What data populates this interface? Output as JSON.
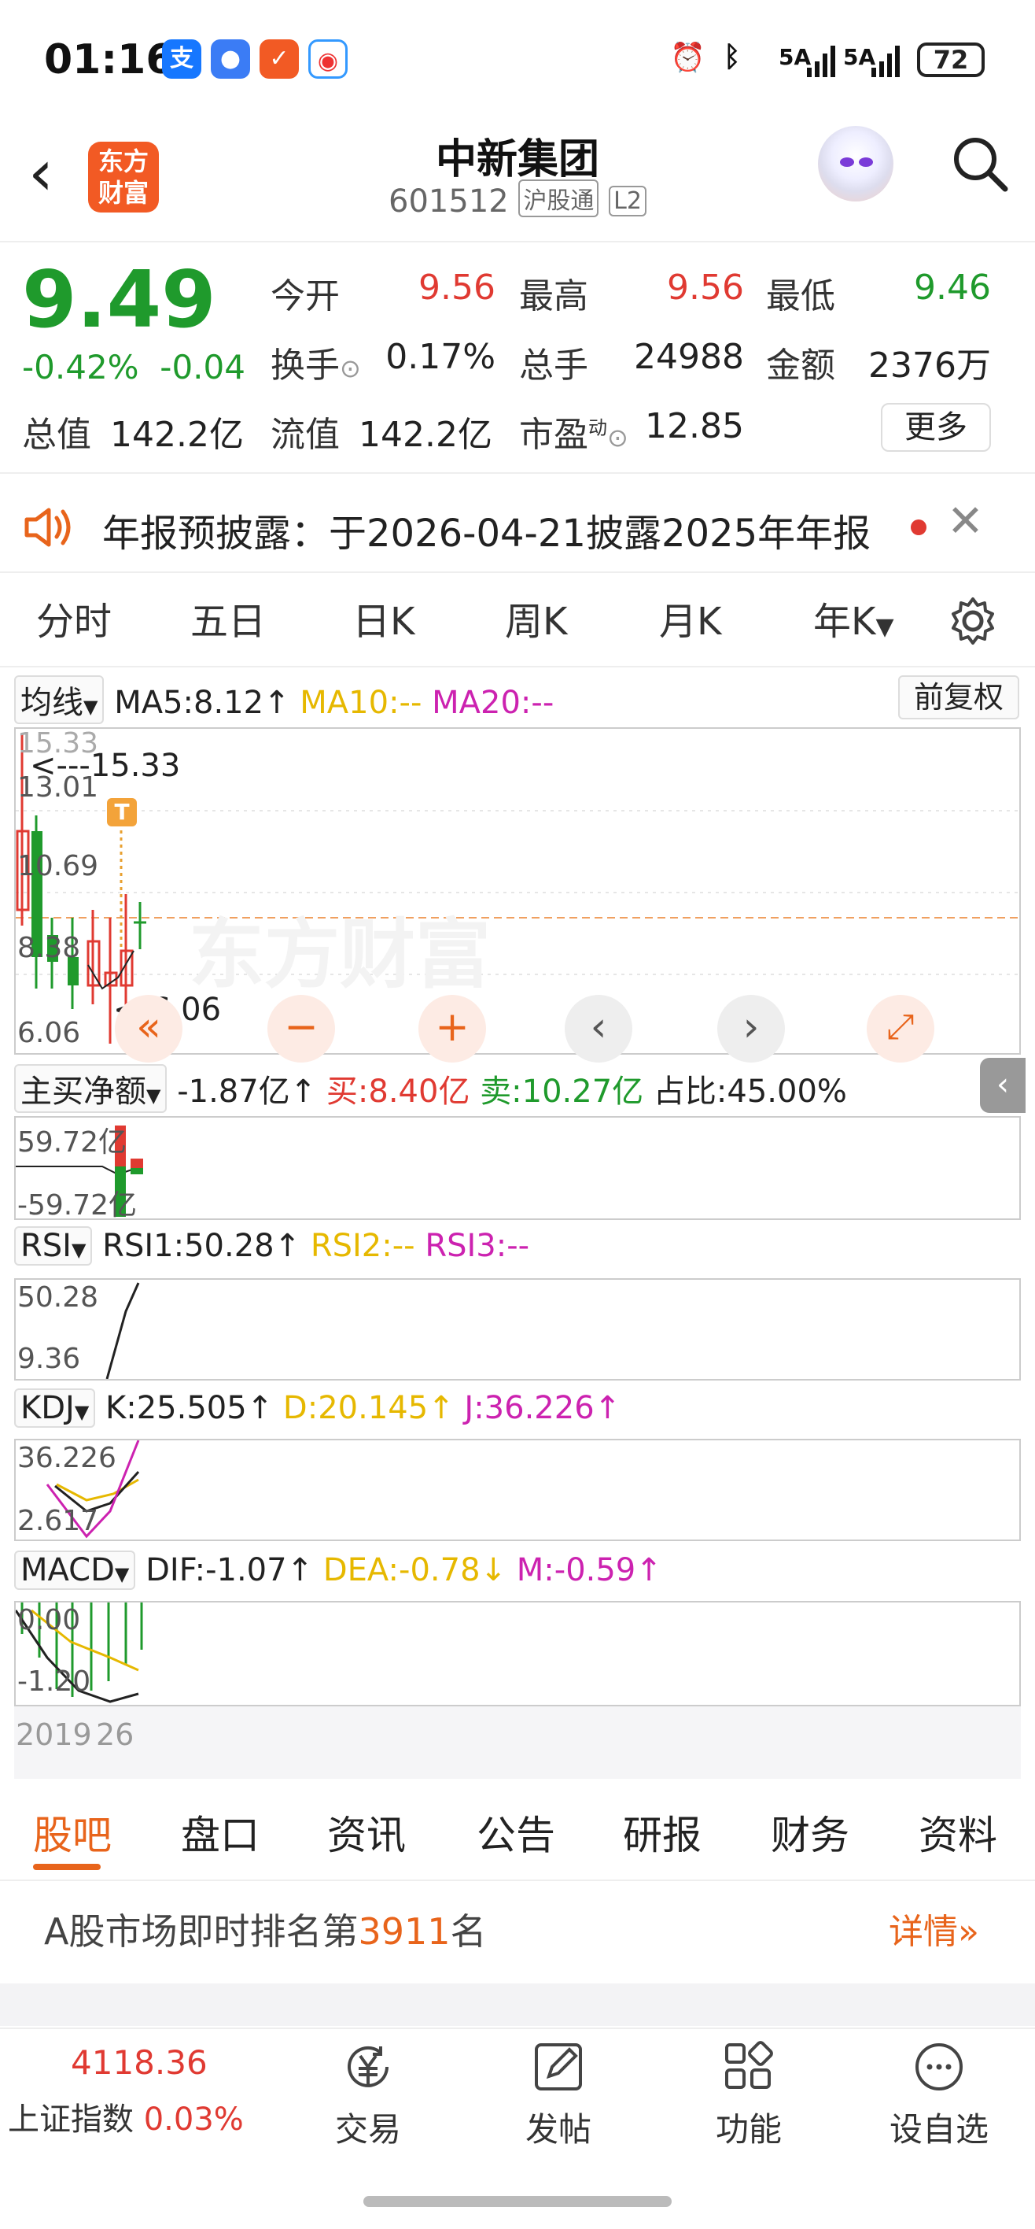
{
  "status_bar": {
    "time": "01:16",
    "net1": "5A",
    "net2": "5A",
    "battery": "72"
  },
  "header": {
    "title": "中新集团",
    "code": "601512",
    "tag1": "沪股通",
    "tag2": "L2",
    "logo_line1": "东方",
    "logo_line2": "财富"
  },
  "quote": {
    "price": "9.49",
    "change_pct": "-0.42%",
    "change_abs": "-0.04",
    "open_label": "今开",
    "open": "9.56",
    "high_label": "最高",
    "high": "9.56",
    "low_label": "最低",
    "low": "9.46",
    "turnover_label": "换手",
    "turnover": "0.17%",
    "volume_label": "总手",
    "volume": "24988",
    "amount_label": "金额",
    "amount": "2376万",
    "mcap_label": "总值",
    "mcap": "142.2亿",
    "float_label": "流值",
    "float": "142.2亿",
    "pe_label": "市盈",
    "pe_sup": "动",
    "pe": "12.85",
    "more": "更多"
  },
  "notice": {
    "text": "年报预披露：于2026-04-21披露2025年年报"
  },
  "period_tabs": [
    "分时",
    "五日",
    "日K",
    "周K",
    "月K",
    "年K"
  ],
  "active_period": "年K",
  "kline": {
    "selector": "均线",
    "ma5": "MA5:8.12",
    "ma10": "MA10:--",
    "ma20": "MA20:--",
    "fuquan": "前复权",
    "y_labels": [
      "15.33",
      "13.01",
      "10.69",
      "8.38",
      "6.06"
    ],
    "max_marker": "<---15.33",
    "min_marker": "<-6.06",
    "t_badge": "T"
  },
  "netbuy": {
    "selector": "主买净额",
    "net": "-1.87亿",
    "buy": "买:8.40亿",
    "sell": "卖:10.27亿",
    "ratio": "占比:45.00%",
    "y_labels": [
      "59.72亿",
      "-59.72亿"
    ]
  },
  "rsi": {
    "selector": "RSI",
    "rsi1": "RSI1:50.28",
    "rsi2": "RSI2:--",
    "rsi3": "RSI3:--",
    "y_labels": [
      "50.28",
      "9.36"
    ]
  },
  "kdj": {
    "selector": "KDJ",
    "k": "K:25.505",
    "d": "D:20.145",
    "j": "J:36.226",
    "y_labels": [
      "36.226",
      "2.617"
    ]
  },
  "macd": {
    "selector": "MACD",
    "dif": "DIF:-1.07",
    "dea": "DEA:-0.78",
    "m": "M:-0.59",
    "y_labels": [
      "0.00",
      "-1.20"
    ]
  },
  "x_axis": {
    "start": "2019",
    "end": "26"
  },
  "content_tabs": [
    "股吧",
    "盘口",
    "资讯",
    "公告",
    "研报",
    "财务",
    "资料"
  ],
  "rank": {
    "prefix": "A股市场即时排名第",
    "number": "3911",
    "suffix": "名",
    "detail": "详情"
  },
  "bottom_nav": {
    "index_value": "4118.36",
    "index_name": "上证指数",
    "index_change": "0.03%",
    "items": [
      "交易",
      "发帖",
      "功能",
      "设自选"
    ]
  },
  "colors": {
    "up": "#e03a32",
    "down": "#1f9a2c",
    "accent": "#e8641b",
    "ma10": "#e6b800",
    "ma20": "#cc22b0"
  }
}
